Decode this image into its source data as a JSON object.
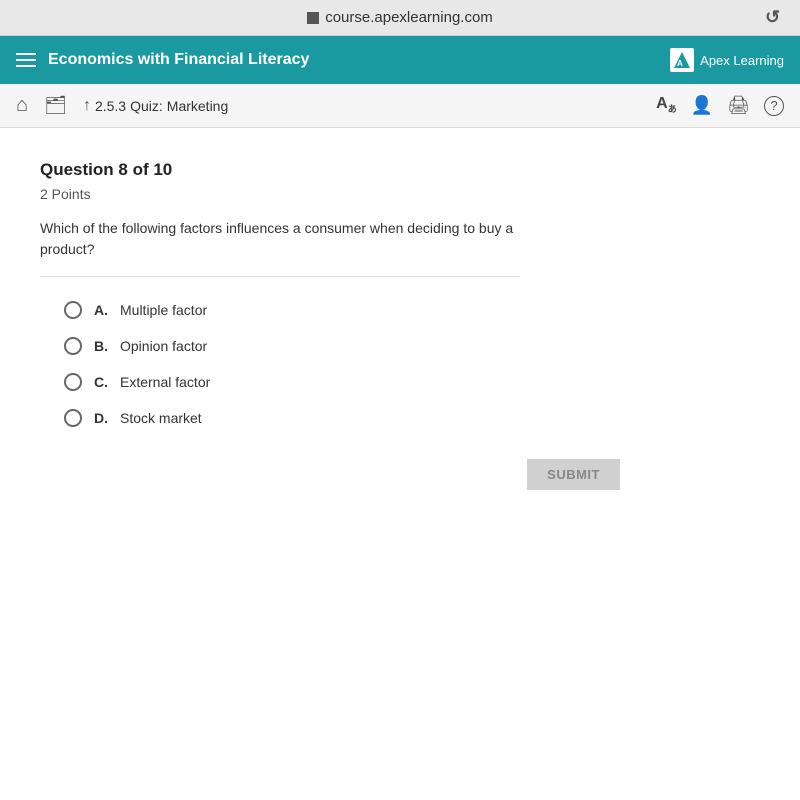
{
  "browser": {
    "url": "course.apexlearning.com",
    "refresh_icon": "↻"
  },
  "header": {
    "menu_icon": "menu",
    "title": "Economics with Financial Literacy",
    "logo_text": "Apex Learning"
  },
  "navbar": {
    "home_icon": "⌂",
    "portfolio_icon": "🗂",
    "breadcrumb": {
      "arrow": "↑",
      "quiz_label": "2.5.3",
      "quiz_type": "Quiz:",
      "quiz_name": "Marketing"
    },
    "translate_icon": "A",
    "user_icon": "👤",
    "print_icon": "🖨",
    "help_icon": "?"
  },
  "question": {
    "title": "Question 8 of 10",
    "points": "2 Points",
    "text": "Which of the following factors influences a consumer when deciding to buy a product?",
    "options": [
      {
        "letter": "A.",
        "text": "Multiple factor"
      },
      {
        "letter": "B.",
        "text": "Opinion factor"
      },
      {
        "letter": "C.",
        "text": "External factor"
      },
      {
        "letter": "D.",
        "text": "Stock market"
      }
    ]
  },
  "submit": {
    "label": "SUBMIT"
  }
}
